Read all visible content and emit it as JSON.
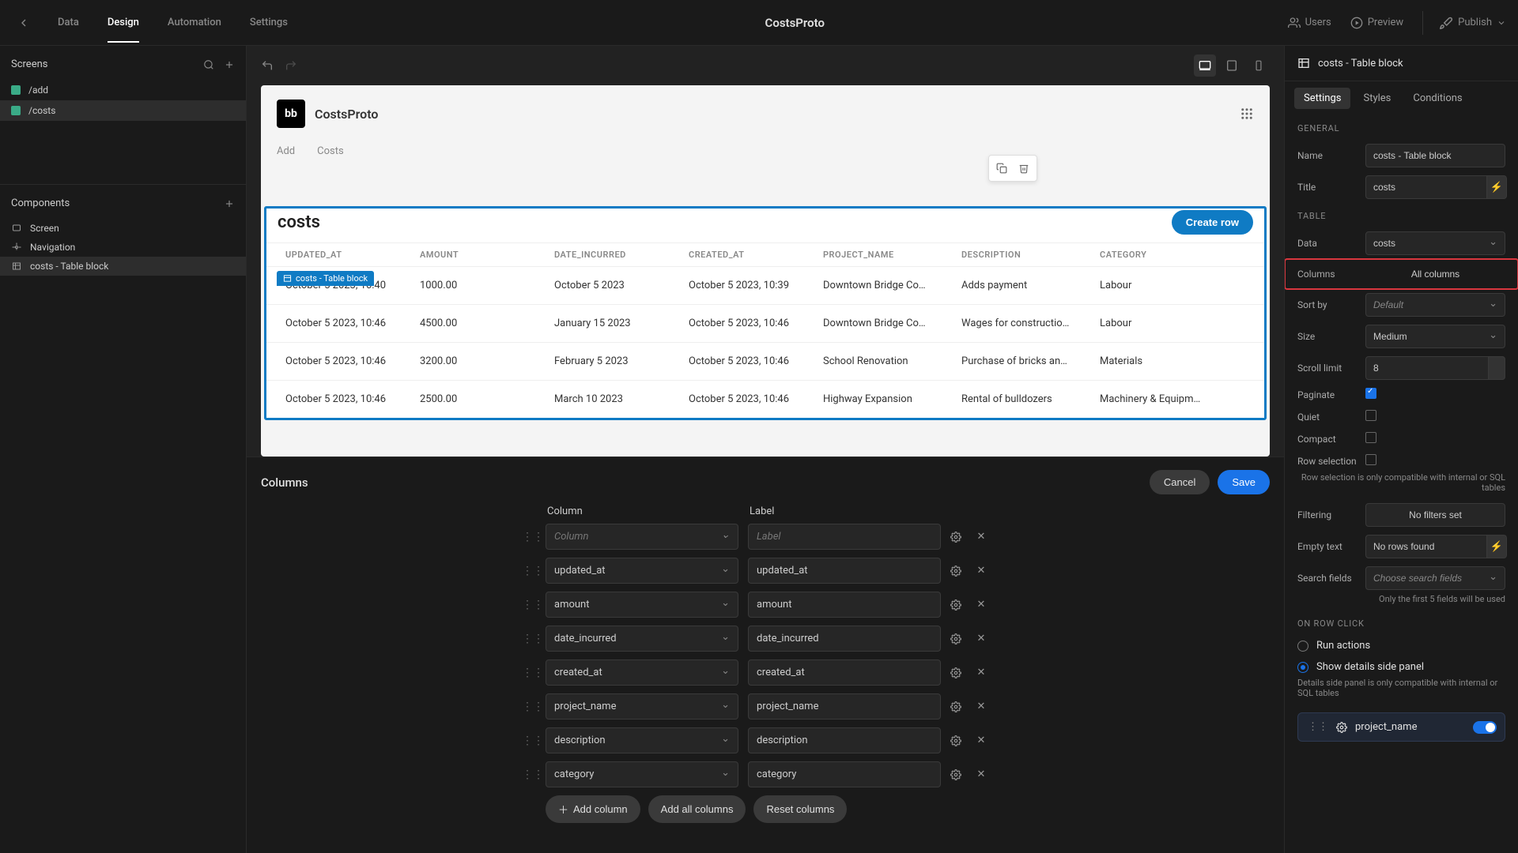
{
  "nav": {
    "tabs": [
      "Data",
      "Design",
      "Automation",
      "Settings"
    ],
    "activeTab": "Design",
    "center": "CostsProto",
    "users": "Users",
    "preview": "Preview",
    "publish": "Publish"
  },
  "left": {
    "screens": {
      "title": "Screens",
      "items": [
        "/add",
        "/costs"
      ],
      "selected": "/costs"
    },
    "components": {
      "title": "Components",
      "items": [
        {
          "label": "Screen",
          "icon": "screen"
        },
        {
          "label": "Navigation",
          "icon": "nav"
        },
        {
          "label": "costs - Table block",
          "icon": "table",
          "selected": true
        }
      ]
    }
  },
  "canvas": {
    "appTitle": "CostsProto",
    "appTabs": [
      "Add",
      "Costs"
    ],
    "blockChip": "costs - Table block",
    "tableTitle": "costs",
    "createRow": "Create row",
    "headers": [
      "UPDATED_AT",
      "AMOUNT",
      "DATE_INCURRED",
      "CREATED_AT",
      "PROJECT_NAME",
      "DESCRIPTION",
      "CATEGORY"
    ],
    "rows": [
      [
        "October 5 2023, 10:40",
        "1000.00",
        "October 5 2023",
        "October 5 2023, 10:39",
        "Downtown Bridge Co…",
        "Adds payment",
        "Labour"
      ],
      [
        "October 5 2023, 10:46",
        "4500.00",
        "January 15 2023",
        "October 5 2023, 10:46",
        "Downtown Bridge Co…",
        "Wages for constructio…",
        "Labour"
      ],
      [
        "October 5 2023, 10:46",
        "3200.00",
        "February 5 2023",
        "October 5 2023, 10:46",
        "School Renovation",
        "Purchase of bricks an…",
        "Materials"
      ],
      [
        "October 5 2023, 10:46",
        "2500.00",
        "March 10 2023",
        "October 5 2023, 10:46",
        "Highway Expansion",
        "Rental of bulldozers",
        "Machinery & Equipm…"
      ]
    ]
  },
  "columnsPanel": {
    "title": "Columns",
    "cancel": "Cancel",
    "save": "Save",
    "colHeader": "Column",
    "labelHeader": "Label",
    "rows": [
      {
        "column": "Column",
        "label": "Label",
        "placeholder": true
      },
      {
        "column": "updated_at",
        "label": "updated_at"
      },
      {
        "column": "amount",
        "label": "amount"
      },
      {
        "column": "date_incurred",
        "label": "date_incurred"
      },
      {
        "column": "created_at",
        "label": "created_at"
      },
      {
        "column": "project_name",
        "label": "project_name"
      },
      {
        "column": "description",
        "label": "description"
      },
      {
        "column": "category",
        "label": "category"
      }
    ],
    "addColumn": "Add column",
    "addAll": "Add all columns",
    "reset": "Reset columns"
  },
  "right": {
    "headTitle": "costs - Table block",
    "tabs": [
      "Settings",
      "Styles",
      "Conditions"
    ],
    "activeTab": "Settings",
    "general": {
      "title": "GENERAL",
      "name": {
        "label": "Name",
        "value": "costs - Table block"
      },
      "titleF": {
        "label": "Title",
        "value": "costs"
      }
    },
    "table": {
      "title": "TABLE",
      "data": {
        "label": "Data",
        "value": "costs"
      },
      "columns": {
        "label": "Columns",
        "value": "All columns"
      },
      "sortby": {
        "label": "Sort by",
        "value": "Default"
      },
      "size": {
        "label": "Size",
        "value": "Medium"
      },
      "scroll": {
        "label": "Scroll limit",
        "value": "8"
      },
      "paginate": {
        "label": "Paginate",
        "on": true
      },
      "quiet": {
        "label": "Quiet",
        "on": false
      },
      "compact": {
        "label": "Compact",
        "on": false
      },
      "rowsel": {
        "label": "Row selection",
        "on": false
      },
      "rowselHint": "Row selection is only compatible with internal or SQL tables",
      "filtering": {
        "label": "Filtering",
        "value": "No filters set"
      },
      "empty": {
        "label": "Empty text",
        "value": "No rows found"
      },
      "search": {
        "label": "Search fields",
        "value": "Choose search fields"
      },
      "searchHint": "Only the first 5 fields will be used"
    },
    "onclick": {
      "title": "ON ROW CLICK",
      "run": "Run actions",
      "show": "Show details side panel",
      "hint": "Details side panel is only compatible with internal or SQL tables",
      "field": "project_name"
    }
  }
}
